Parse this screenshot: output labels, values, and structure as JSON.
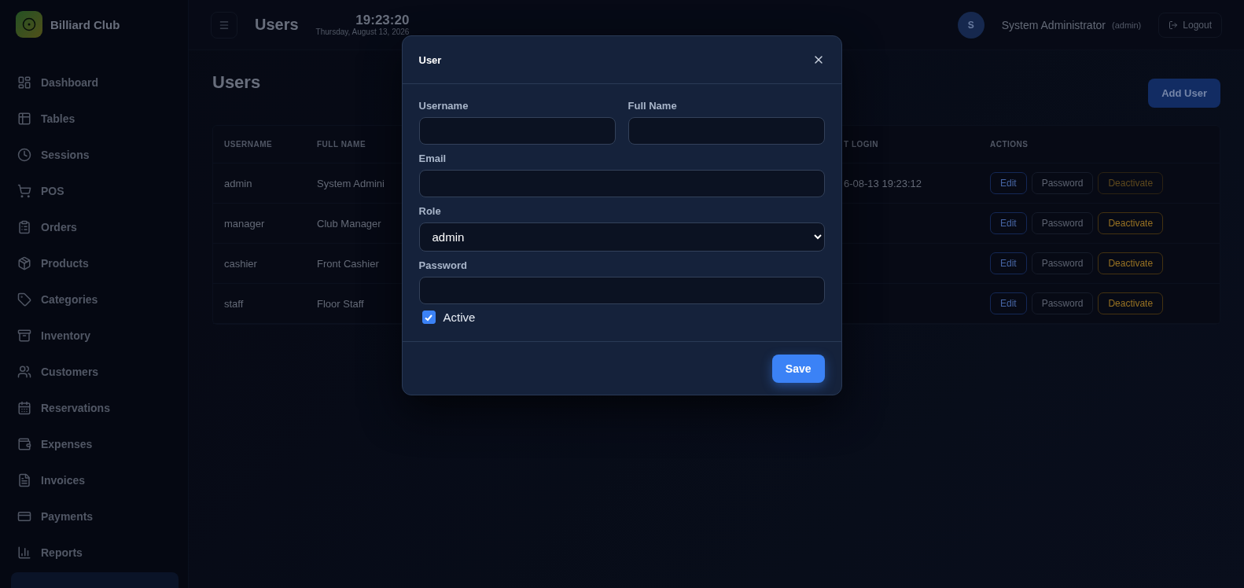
{
  "sidebar": {
    "brand": "Billiard Club",
    "items": [
      {
        "label": "Dashboard"
      },
      {
        "label": "Tables"
      },
      {
        "label": "Sessions"
      },
      {
        "label": "POS"
      },
      {
        "label": "Orders"
      },
      {
        "label": "Products"
      },
      {
        "label": "Categories"
      },
      {
        "label": "Inventory"
      },
      {
        "label": "Customers"
      },
      {
        "label": "Reservations"
      },
      {
        "label": "Expenses"
      },
      {
        "label": "Invoices"
      },
      {
        "label": "Payments"
      },
      {
        "label": "Reports"
      }
    ]
  },
  "header": {
    "title": "Users",
    "time": "19:23:20",
    "date": "Thursday, August 13, 2026",
    "avatar": "S",
    "user_name": "System Administrator",
    "user_role": "(admin)",
    "logout": "Logout"
  },
  "page": {
    "title": "Users",
    "add_button": "Add User",
    "table": {
      "columns": [
        "USERNAME",
        "FULL NAME",
        "T LOGIN",
        "ACTIONS"
      ],
      "rows": [
        {
          "username": "admin",
          "full_name": "System Admini",
          "last_login": "6-08-13 19:23:12",
          "actions": [
            {
              "label": "Edit",
              "kind": "edit",
              "disabled": false
            },
            {
              "label": "Password",
              "kind": "password",
              "disabled": false
            },
            {
              "label": "Deactivate",
              "kind": "deactivate",
              "disabled": true
            }
          ]
        },
        {
          "username": "manager",
          "full_name": "Club Manager",
          "actions": [
            {
              "label": "Edit",
              "kind": "edit",
              "disabled": false
            },
            {
              "label": "Password",
              "kind": "password",
              "disabled": false
            },
            {
              "label": "Deactivate",
              "kind": "deactivate",
              "disabled": false
            }
          ]
        },
        {
          "username": "cashier",
          "full_name": "Front Cashier",
          "actions": [
            {
              "label": "Edit",
              "kind": "edit",
              "disabled": false
            },
            {
              "label": "Password",
              "kind": "password",
              "disabled": false
            },
            {
              "label": "Deactivate",
              "kind": "deactivate",
              "disabled": false
            }
          ]
        },
        {
          "username": "staff",
          "full_name": "Floor Staff",
          "actions": [
            {
              "label": "Edit",
              "kind": "edit",
              "disabled": false
            },
            {
              "label": "Password",
              "kind": "password",
              "disabled": false
            },
            {
              "label": "Deactivate",
              "kind": "deactivate",
              "disabled": false
            }
          ]
        }
      ]
    }
  },
  "dialog": {
    "title": "User",
    "fields": {
      "username": {
        "label": "Username"
      },
      "full_name": {
        "label": "Full Name"
      },
      "email": {
        "label": "Email"
      },
      "role": {
        "label": "Role",
        "value": "admin"
      },
      "password": {
        "label": "Password"
      }
    },
    "active": {
      "label": "Active",
      "checked": true
    },
    "save": "Save"
  }
}
